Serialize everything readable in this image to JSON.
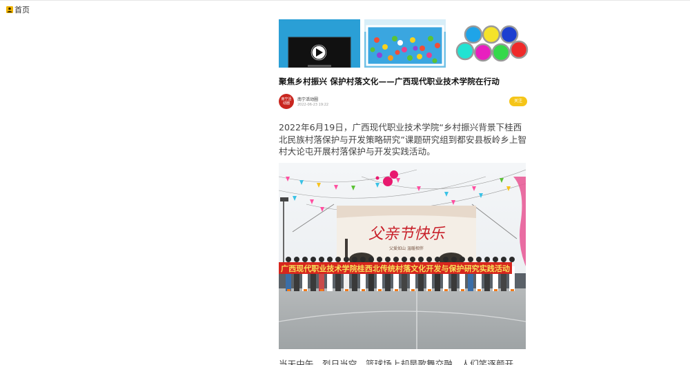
{
  "nav": {
    "home_label": "首页",
    "home_icon": "user-icon"
  },
  "thumbnails": [
    {
      "name": "video-thumbnail",
      "icon": "play-icon"
    },
    {
      "name": "ball-pool-thumbnail"
    },
    {
      "name": "paint-buckets-thumbnail"
    }
  ],
  "article": {
    "title": "聚焦乡村振兴 保护村落文化——广西现代职业技术学院在行动",
    "author": {
      "avatar_text": "南宁活动圈",
      "name": "南宁活动圈",
      "time": "2022-06-23 19:22",
      "follow_label": "关注"
    },
    "intro": "2022年6月19日，广西现代职业技术学院“乡村振兴背景下桂西北民族村落保护与开发策略研究”课题研究组到都安县板岭乡上智村大论屯开展村落保护与开发实践活动。",
    "photo": {
      "backdrop_text": "父亲节快乐",
      "backdrop_subtext": "父爱如山 温暖相伴",
      "banner_text": "广西现代职业技术学院桂西北传统村落文化开发与保护研究实践活动"
    },
    "next_line": "当天中午，烈日当空，篮球场上却是歌舞交融，人们笑逐颜开"
  },
  "colors": {
    "follow_button": "#f5c518",
    "avatar_bg": "#c9261f",
    "banner_red": "#d7261e",
    "banner_text": "#f6e05a"
  }
}
